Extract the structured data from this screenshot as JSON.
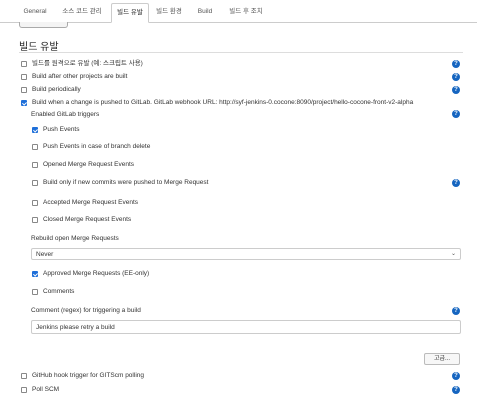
{
  "tabs": [
    {
      "label": "General"
    },
    {
      "label": "소스 코드 관리"
    },
    {
      "label": "빌드 유발"
    },
    {
      "label": "빌드 환경"
    },
    {
      "label": "Build"
    },
    {
      "label": "빌드 후 조치"
    }
  ],
  "section": {
    "title": "빌드 유발"
  },
  "triggers": [
    {
      "label": "빌드를 원격으로 유발 (예: 스크립트 사용)",
      "checked": false
    },
    {
      "label": "Build after other projects are built",
      "checked": false
    },
    {
      "label": "Build periodically",
      "checked": false
    },
    {
      "label": "Build when a change is pushed to GitLab. GitLab webhook URL: http://syf-jenkins-0.cocone:8090/project/hello-cocone-front-v2-alpha",
      "checked": true
    }
  ],
  "gitlab": {
    "enabled_label": "Enabled GitLab triggers",
    "options": [
      {
        "label": "Push Events",
        "checked": true
      },
      {
        "label": "Push Events in case of branch delete",
        "checked": false
      },
      {
        "label": "Opened Merge Request Events",
        "checked": false
      },
      {
        "label": "Build only if new commits were pushed to Merge Request",
        "checked": false
      },
      {
        "label": "Accepted Merge Request Events",
        "checked": false
      },
      {
        "label": "Closed Merge Request Events",
        "checked": false
      }
    ],
    "rebuild_label": "Rebuild open Merge Requests",
    "rebuild_value": "Never",
    "approved": {
      "label": "Approved Merge Requests (EE-only)",
      "checked": true
    },
    "comments": {
      "label": "Comments",
      "checked": false
    },
    "comment_regex_label": "Comment (regex) for triggering a build",
    "comment_regex_value": "Jenkins please retry a build",
    "advanced_label": "고급..."
  },
  "bottom_triggers": [
    {
      "label": "GitHub hook trigger for GITScm polling",
      "checked": false
    },
    {
      "label": "Poll SCM",
      "checked": false
    }
  ],
  "colors": {
    "accent": "#1e6fd9",
    "help": "#1565c0"
  },
  "help_icon": "?"
}
